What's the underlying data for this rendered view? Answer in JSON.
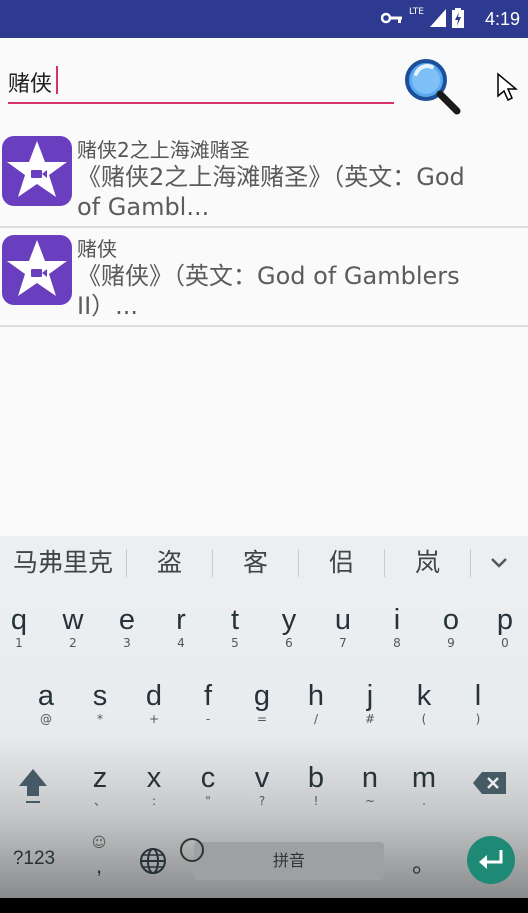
{
  "status_bar": {
    "time": "4:19",
    "network": "LTE"
  },
  "search": {
    "value": "赌侠"
  },
  "results": [
    {
      "title": "赌侠2之上海滩赌圣",
      "desc_line1": "《赌侠2之上海滩赌圣》（英文：God",
      "desc_line2": "of Gambl..."
    },
    {
      "title": "赌侠",
      "desc_line1": "《赌侠》（英文：God of Gamblers",
      "desc_line2": "II）..."
    }
  ],
  "keyboard": {
    "candidates": [
      "马弗里克",
      "盗",
      "客",
      "侣",
      "岚"
    ],
    "row1": [
      {
        "k": "q",
        "s": "1"
      },
      {
        "k": "w",
        "s": "2"
      },
      {
        "k": "e",
        "s": "3"
      },
      {
        "k": "r",
        "s": "4"
      },
      {
        "k": "t",
        "s": "5"
      },
      {
        "k": "y",
        "s": "6"
      },
      {
        "k": "u",
        "s": "7"
      },
      {
        "k": "i",
        "s": "8"
      },
      {
        "k": "o",
        "s": "9"
      },
      {
        "k": "p",
        "s": "0"
      }
    ],
    "row2": [
      {
        "k": "a",
        "s": "@"
      },
      {
        "k": "s",
        "s": "*"
      },
      {
        "k": "d",
        "s": "+"
      },
      {
        "k": "f",
        "s": "-"
      },
      {
        "k": "g",
        "s": "="
      },
      {
        "k": "h",
        "s": "/"
      },
      {
        "k": "j",
        "s": "#"
      },
      {
        "k": "k",
        "s": "("
      },
      {
        "k": "l",
        "s": ")"
      }
    ],
    "row3": [
      {
        "k": "z",
        "s": "、"
      },
      {
        "k": "x",
        "s": ":"
      },
      {
        "k": "c",
        "s": "\""
      },
      {
        "k": "v",
        "s": "?"
      },
      {
        "k": "b",
        "s": "!"
      },
      {
        "k": "n",
        "s": "~"
      },
      {
        "k": "m",
        "s": "."
      }
    ],
    "symbols_label": "?123",
    "comma": ",",
    "comma_sub": "☺",
    "space_label": "拼音",
    "period": "。"
  }
}
